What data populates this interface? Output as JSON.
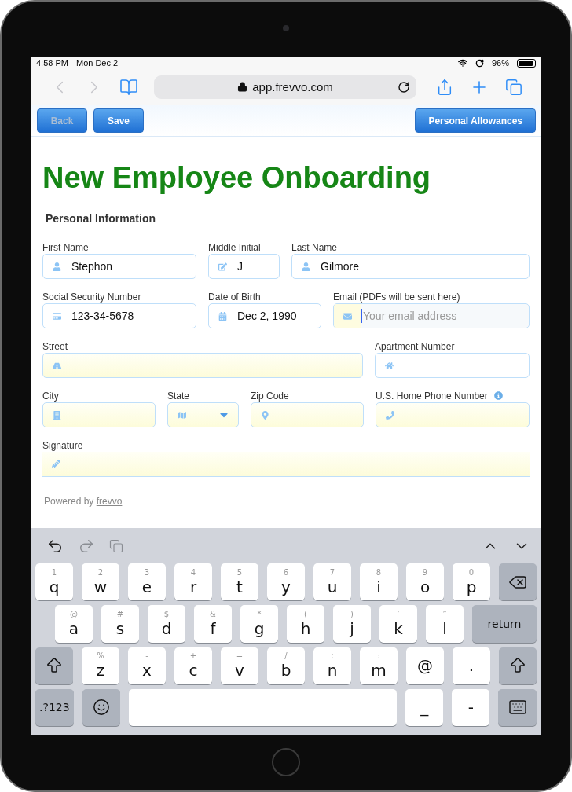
{
  "status_bar": {
    "time": "4:58 PM",
    "date": "Mon Dec 2",
    "battery": "96%"
  },
  "browser": {
    "url": "app.frevvo.com"
  },
  "form_toolbar": {
    "left_buttons": [
      {
        "label": "Back",
        "disabled": true
      },
      {
        "label": "Save",
        "disabled": false
      }
    ],
    "right_buttons": [
      {
        "label": "Personal Allowances",
        "disabled": false
      }
    ]
  },
  "form": {
    "title": "New Employee Onboarding",
    "section": "Personal Information",
    "fields": [
      {
        "label": "First Name",
        "value": "Stephon",
        "kind": "text",
        "required": false,
        "focused": false,
        "info": false
      },
      {
        "label": "Middle Initial",
        "value": "J",
        "kind": "text",
        "required": false,
        "focused": false,
        "info": false
      },
      {
        "label": "Last Name",
        "value": "Gilmore",
        "kind": "text",
        "required": false,
        "focused": false,
        "info": false
      },
      {
        "label": "Social Security Number",
        "value": "123-34-5678",
        "kind": "text",
        "required": false,
        "focused": false,
        "info": false
      },
      {
        "label": "Date of Birth",
        "value": "Dec 2, 1990",
        "kind": "text",
        "required": false,
        "focused": false,
        "info": false
      },
      {
        "label": "Email (PDFs will be sent here)",
        "placeholder": "Your email address",
        "kind": "text",
        "required": false,
        "focused": true,
        "info": false
      },
      {
        "label": "Street",
        "kind": "text",
        "required": true,
        "focused": false,
        "info": false
      },
      {
        "label": "Apartment Number",
        "kind": "text",
        "required": false,
        "focused": false,
        "info": false
      },
      {
        "label": "City",
        "kind": "text",
        "required": true,
        "focused": false,
        "info": false
      },
      {
        "label": "State",
        "kind": "select",
        "required": true,
        "focused": false,
        "info": false
      },
      {
        "label": "Zip Code",
        "kind": "text",
        "required": true,
        "focused": false,
        "info": false
      },
      {
        "label": "U.S. Home Phone Number",
        "kind": "text",
        "required": true,
        "focused": false,
        "info": true
      },
      {
        "label": "Signature",
        "kind": "signature",
        "required": true,
        "focused": false,
        "info": false
      }
    ],
    "footer": {
      "text": "Powered by",
      "link": "frevvo"
    }
  },
  "keyboard": {
    "toolbar": [
      {
        "kind": "undo",
        "disabled": false
      },
      {
        "kind": "redo",
        "disabled": true
      },
      {
        "kind": "paste",
        "disabled": true
      },
      {
        "kind": "previous",
        "disabled": false
      },
      {
        "kind": "next",
        "disabled": false
      }
    ],
    "keys": [
      {
        "kind": "letter",
        "label": "q",
        "hint": "1"
      },
      {
        "kind": "letter",
        "label": "w",
        "hint": "2"
      },
      {
        "kind": "letter",
        "label": "e",
        "hint": "3"
      },
      {
        "kind": "letter",
        "label": "r",
        "hint": "4"
      },
      {
        "kind": "letter",
        "label": "t",
        "hint": "5"
      },
      {
        "kind": "letter",
        "label": "y",
        "hint": "6"
      },
      {
        "kind": "letter",
        "label": "u",
        "hint": "7"
      },
      {
        "kind": "letter",
        "label": "i",
        "hint": "8"
      },
      {
        "kind": "letter",
        "label": "o",
        "hint": "9"
      },
      {
        "kind": "letter",
        "label": "p",
        "hint": "0"
      },
      {
        "kind": "delete"
      },
      {
        "kind": "letter",
        "label": "a",
        "hint": "@"
      },
      {
        "kind": "letter",
        "label": "s",
        "hint": "#"
      },
      {
        "kind": "letter",
        "label": "d",
        "hint": "$"
      },
      {
        "kind": "letter",
        "label": "f",
        "hint": "&"
      },
      {
        "kind": "letter",
        "label": "g",
        "hint": "*"
      },
      {
        "kind": "letter",
        "label": "h",
        "hint": "("
      },
      {
        "kind": "letter",
        "label": "j",
        "hint": ")"
      },
      {
        "kind": "letter",
        "label": "k",
        "hint": "’"
      },
      {
        "kind": "letter",
        "label": "l",
        "hint": "”"
      },
      {
        "kind": "return",
        "label": "return"
      },
      {
        "kind": "shift"
      },
      {
        "kind": "letter",
        "label": "z",
        "hint": "%"
      },
      {
        "kind": "letter",
        "label": "x",
        "hint": "-"
      },
      {
        "kind": "letter",
        "label": "c",
        "hint": "+"
      },
      {
        "kind": "letter",
        "label": "v",
        "hint": "="
      },
      {
        "kind": "letter",
        "label": "b",
        "hint": "/"
      },
      {
        "kind": "letter",
        "label": "n",
        "hint": ";"
      },
      {
        "kind": "letter",
        "label": "m",
        "hint": ":"
      },
      {
        "kind": "letter",
        "label": "@"
      },
      {
        "kind": "letter",
        "label": "."
      },
      {
        "kind": "shift"
      },
      {
        "kind": "numbers",
        "label": ".?123"
      },
      {
        "kind": "emoji"
      },
      {
        "kind": "space"
      },
      {
        "kind": "letter",
        "label": "_"
      },
      {
        "kind": "letter",
        "label": "-"
      },
      {
        "kind": "hide"
      }
    ]
  }
}
